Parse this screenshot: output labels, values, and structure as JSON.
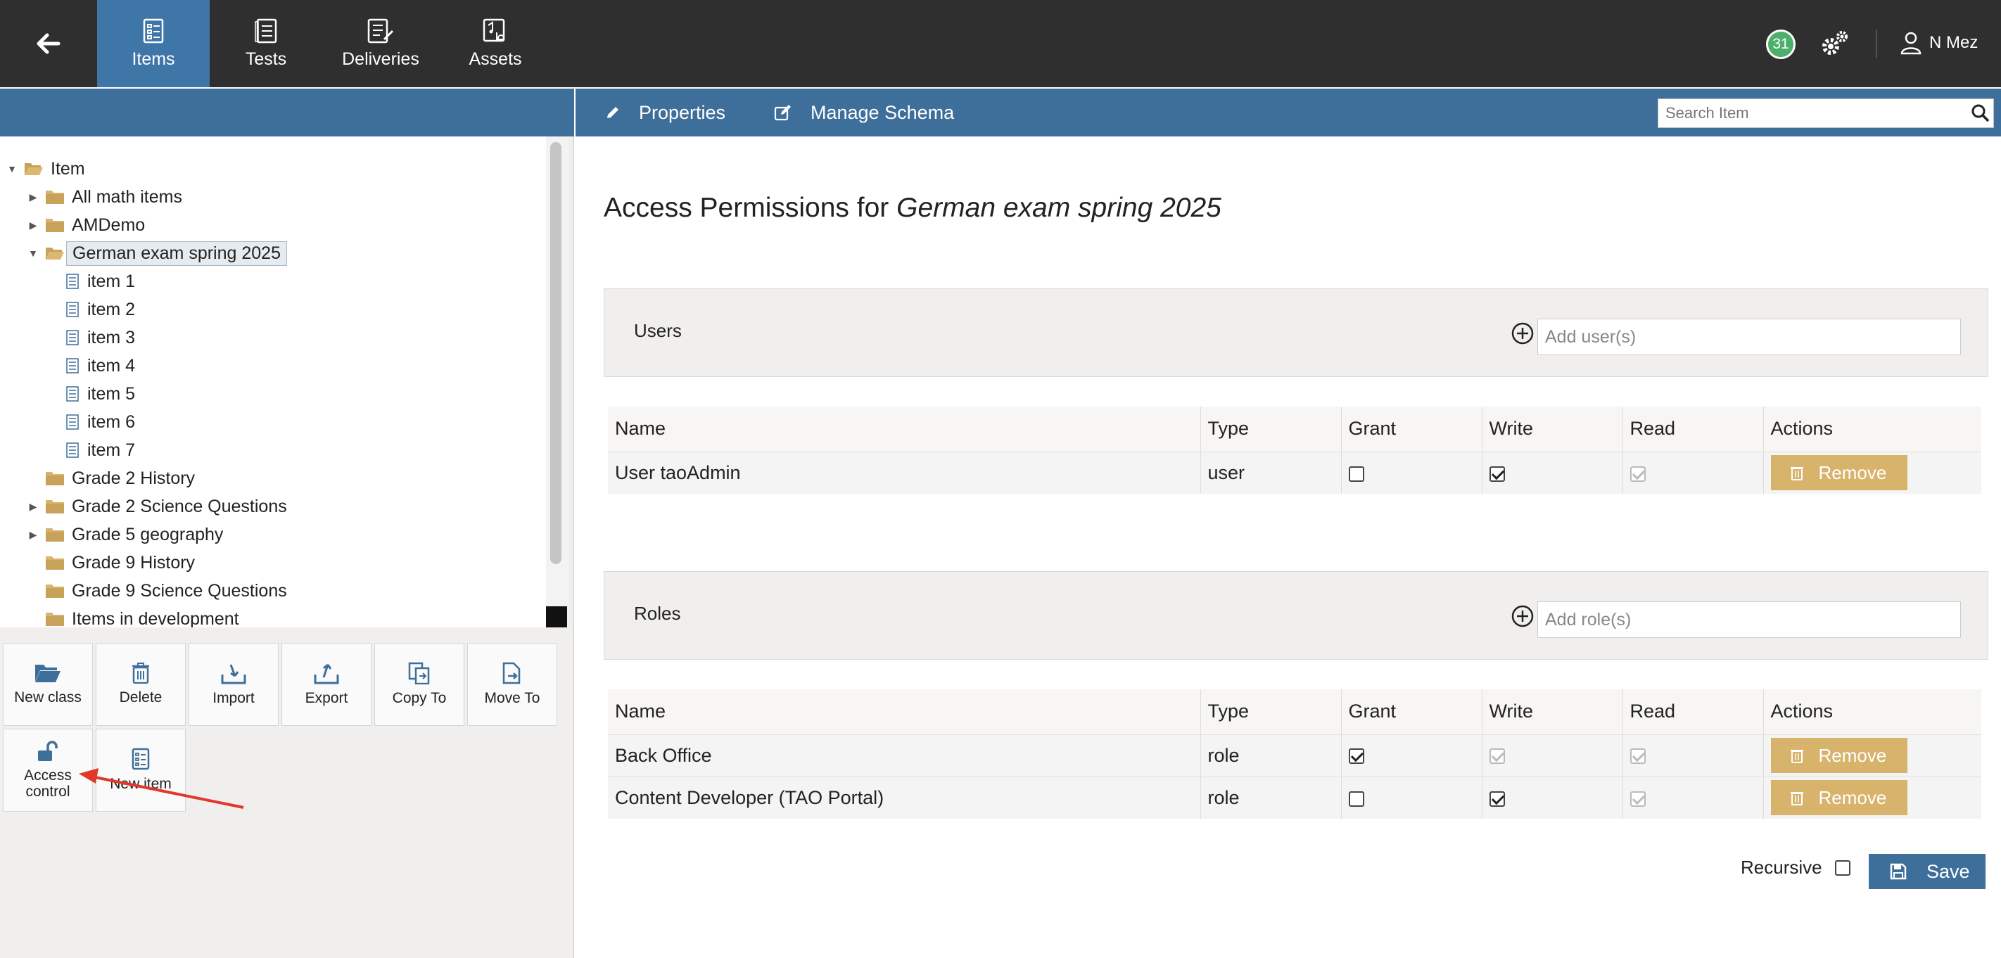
{
  "nav": {
    "tabs": [
      {
        "label": "Items",
        "icon": "items-icon",
        "active": true
      },
      {
        "label": "Tests",
        "icon": "tests-icon"
      },
      {
        "label": "Deliveries",
        "icon": "deliveries-icon"
      },
      {
        "label": "Assets",
        "icon": "assets-icon"
      }
    ],
    "notification_count": "31",
    "user_name": "N Mez",
    "active_color": "#3e76a8"
  },
  "tree": {
    "root": "Item",
    "children": [
      "All math items",
      "AMDemo",
      "German exam spring 2025",
      "item 1",
      "item 2",
      "item 3",
      "item 4",
      "item 5",
      "item 6",
      "item 7",
      "Grade 2 History",
      "Grade 2 Science Questions",
      "Grade 5 geography",
      "Grade 9 History",
      "Grade 9 Science Questions",
      "Items in development"
    ],
    "selected": "German exam spring 2025"
  },
  "toolbar": {
    "new_class": "New class",
    "delete": "Delete",
    "import": "Import",
    "export": "Export",
    "copy_to": "Copy To",
    "move_to": "Move To",
    "access_control_1": "Access",
    "access_control_2": "control",
    "new_item": "New item"
  },
  "header": {
    "properties": "Properties",
    "manage_schema": "Manage Schema",
    "search_placeholder": "Search Item"
  },
  "main": {
    "title_prefix": "Access Permissions for",
    "title_subject": "German exam spring 2025",
    "users_section": "Users",
    "users_placeholder": "Add user(s)",
    "roles_section": "Roles",
    "roles_placeholder": "Add role(s)",
    "columns": [
      "Name",
      "Type",
      "Grant",
      "Write",
      "Read",
      "Actions"
    ],
    "users": [
      {
        "name": "User taoAdmin",
        "type": "user",
        "grant": false,
        "write": true,
        "read": true
      }
    ],
    "roles": [
      {
        "name": "Back Office",
        "type": "role",
        "grant": true,
        "write": true,
        "read": true
      },
      {
        "name": "Content Developer (TAO Portal)",
        "type": "role",
        "grant": false,
        "write": true,
        "read": true
      }
    ],
    "remove_label": "Remove",
    "recursive_label": "Recursive",
    "save_label": "Save"
  }
}
